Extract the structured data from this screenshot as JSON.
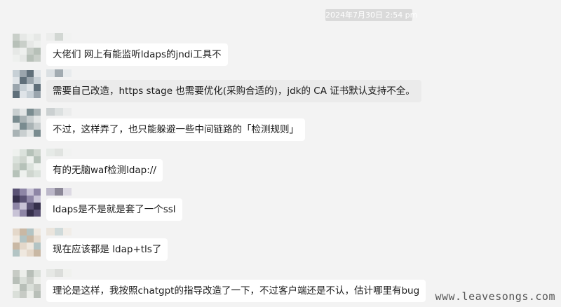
{
  "chat": {
    "timestamp": "2024年7月30日 2:54 pm",
    "messages": [
      {
        "text": "大佬们 网上有能监听ldaps的jndi工具不",
        "highlighted": false
      },
      {
        "text": "需要自己改造，https stage 也需要优化(采购合适的)，jdk的 CA 证书默认支持不全。",
        "highlighted": true
      },
      {
        "text": "不过，这样弄了，也只能躲避一些中间链路的「检测规则」",
        "highlighted": false
      },
      {
        "text": "有的无脑waf检测ldap://",
        "highlighted": false
      },
      {
        "text": "ldaps是不是就是套了一个ssl",
        "highlighted": false
      },
      {
        "text": "现在应该都是 ldap+tls了",
        "highlighted": false
      },
      {
        "text": "理论是这样，我按照chatgpt的指导改造了一下，不过客户端还是不认，估计哪里有bug",
        "highlighted": false
      }
    ]
  },
  "watermark": "www.leavesongs.com",
  "colors": {
    "background": "#f3f3f3",
    "bubble": "#ffffff",
    "bubble_highlighted": "#ebebeb",
    "timestamp_bg": "#dadada"
  },
  "avatar_palettes": [
    [
      "#c9cfc9",
      "#e6e8e6",
      "#b7c0b8",
      "#eef0ee"
    ],
    [
      "#9aa5ad",
      "#c7d0d6",
      "#5f6f7a",
      "#dfe4e8"
    ],
    [
      "#7a8c90",
      "#a9b3b5",
      "#c9cfd0",
      "#e3e6e6"
    ],
    [
      "#b6c2b9",
      "#dbe2dc",
      "#cfd6cf",
      "#eef1ee"
    ],
    [
      "#5a5274",
      "#8e86a6",
      "#36304c",
      "#c8c3d6"
    ],
    [
      "#c9b8a4",
      "#e4d8ca",
      "#b3c4c4",
      "#efe8df"
    ],
    [
      "#b8bfb8",
      "#dadfd9",
      "#c7cbc5",
      "#eceeea"
    ]
  ]
}
